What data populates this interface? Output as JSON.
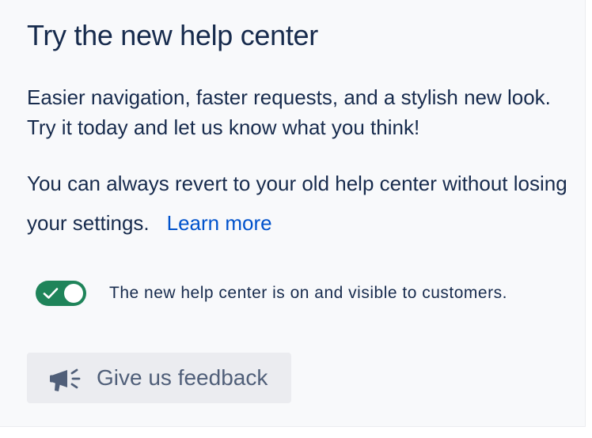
{
  "panel": {
    "title": "Try the new help center",
    "description": "Easier navigation, faster requests, and a stylish new look. Try it today and let us know what you think!",
    "revert_text": "You can always revert to your old help center without losing your settings.",
    "learn_more_label": "Learn more"
  },
  "toggle": {
    "state": "on",
    "label": "The new help center is on and visible to customers."
  },
  "feedback": {
    "label": "Give us feedback",
    "icon": "megaphone-icon"
  },
  "colors": {
    "title": "#172b4d",
    "link": "#0052cc",
    "toggle_on": "#1f845a",
    "button_bg": "#ebecf0",
    "button_text": "#505f79",
    "panel_bg": "#f8f9fb"
  }
}
